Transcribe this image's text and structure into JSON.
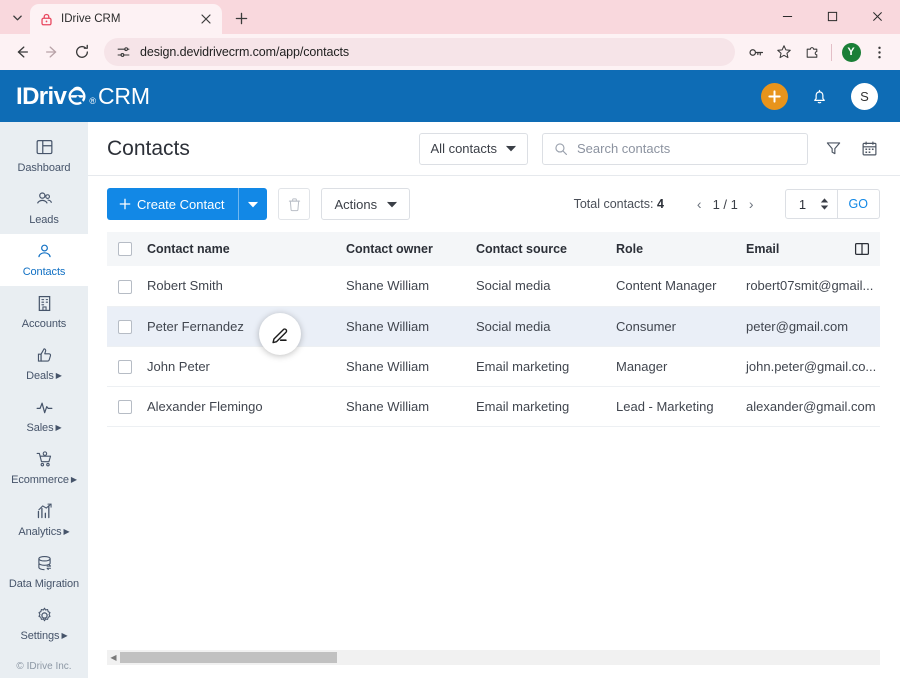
{
  "browser": {
    "tab": {
      "title": "IDrive CRM",
      "favicon": "lock-icon"
    },
    "newtab_label": "+",
    "url": "design.devidrivecrm.com/app/contacts",
    "window_controls": {
      "minimize": "–",
      "maximize": "☐",
      "close": "✕"
    },
    "profile_initial": "Y",
    "icons": [
      "back-icon",
      "forward-icon",
      "reload-icon",
      "site-settings-icon",
      "password-key-icon",
      "bookmark-star-icon",
      "extensions-icon",
      "browser-menu-icon"
    ]
  },
  "app": {
    "logo": {
      "brand": "IDriv",
      "mark": "e",
      "registered": "®",
      "suffix": "CRM"
    },
    "header_actions": {
      "create": "+",
      "notifications": "bell-icon",
      "avatar_initial": "S"
    },
    "accent_blue": "#1288e6",
    "header_blue": "#0e6cb5",
    "accent_orange": "#e8941c"
  },
  "sidebar": {
    "items": [
      {
        "label": "Dashboard",
        "icon": "dashboard-icon",
        "active": false,
        "submenu": false
      },
      {
        "label": "Leads",
        "icon": "leads-icon",
        "active": false,
        "submenu": false
      },
      {
        "label": "Contacts",
        "icon": "contacts-icon",
        "active": true,
        "submenu": false
      },
      {
        "label": "Accounts",
        "icon": "accounts-icon",
        "active": false,
        "submenu": false
      },
      {
        "label": "Deals",
        "icon": "deals-icon",
        "active": false,
        "submenu": true
      },
      {
        "label": "Sales",
        "icon": "sales-icon",
        "active": false,
        "submenu": true
      },
      {
        "label": "Ecommerce",
        "icon": "ecommerce-icon",
        "active": false,
        "submenu": true
      },
      {
        "label": "Analytics",
        "icon": "analytics-icon",
        "active": false,
        "submenu": true
      },
      {
        "label": "Data Migration",
        "icon": "data-migration-icon",
        "active": false,
        "submenu": false
      },
      {
        "label": "Settings",
        "icon": "settings-gear-icon",
        "active": false,
        "submenu": true
      }
    ],
    "copyright": "© IDrive Inc."
  },
  "page": {
    "title": "Contacts",
    "view_filter": "All contacts",
    "search_placeholder": "Search contacts",
    "search_value": "",
    "filter_icon": "funnel-filter-icon",
    "calendar_icon": "calendar-icon"
  },
  "toolbar": {
    "create_label": "Create Contact",
    "create_plus": "+",
    "delete_icon": "trash-icon",
    "actions_label": "Actions",
    "total_label": "Total contacts:",
    "total_count": "4",
    "page_indicator": "1 / 1",
    "prev_arrow": "‹",
    "next_arrow": "›",
    "goto_value": "1",
    "go_label": "GO"
  },
  "table": {
    "columns": [
      "Contact name",
      "Contact owner",
      "Contact source",
      "Role",
      "Email"
    ],
    "column_settings_icon": "column-settings-icon",
    "rows": [
      {
        "name": "Robert Smith",
        "owner": "Shane William",
        "source": "Social media",
        "role": "Content Manager",
        "email": "robert07smit@gmail...",
        "highlighted": false
      },
      {
        "name": "Peter Fernandez",
        "owner": "Shane William",
        "source": "Social media",
        "role": "Consumer",
        "email": "peter@gmail.com",
        "highlighted": true
      },
      {
        "name": "John Peter",
        "owner": "Shane William",
        "source": "Email marketing",
        "role": "Manager",
        "email": "john.peter@gmail.co...",
        "highlighted": false
      },
      {
        "name": "Alexander Flemingo",
        "owner": "Shane William",
        "source": "Email marketing",
        "role": "Lead - Marketing",
        "email": "alexander@gmail.com",
        "highlighted": false
      }
    ],
    "edit_fab_icon": "pencil-edit-icon"
  },
  "scrollbar": {
    "left_arrow": "◀"
  }
}
